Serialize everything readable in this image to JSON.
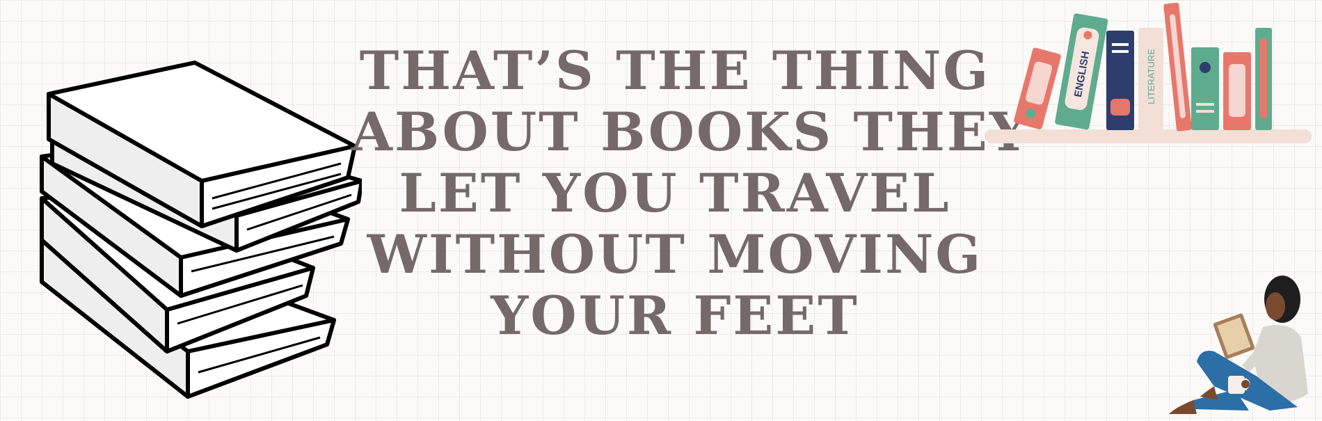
{
  "quote": {
    "lines": [
      "THAT’S THE THING",
      "ABOUT BOOKS THEY",
      "LET YOU TRAVEL",
      "WITHOUT MOVING",
      "YOUR FEET"
    ]
  },
  "shelf": {
    "spines": [
      "ENGLISH",
      "LITERATURE"
    ]
  },
  "colors": {
    "text": "#76696a",
    "coral": "#e8776b",
    "green": "#5fab8e",
    "navy": "#2d3e6c",
    "cream": "#f2dfd6"
  },
  "icons": [
    "book-stack-illustration",
    "bookshelf-illustration",
    "reading-person-illustration"
  ]
}
